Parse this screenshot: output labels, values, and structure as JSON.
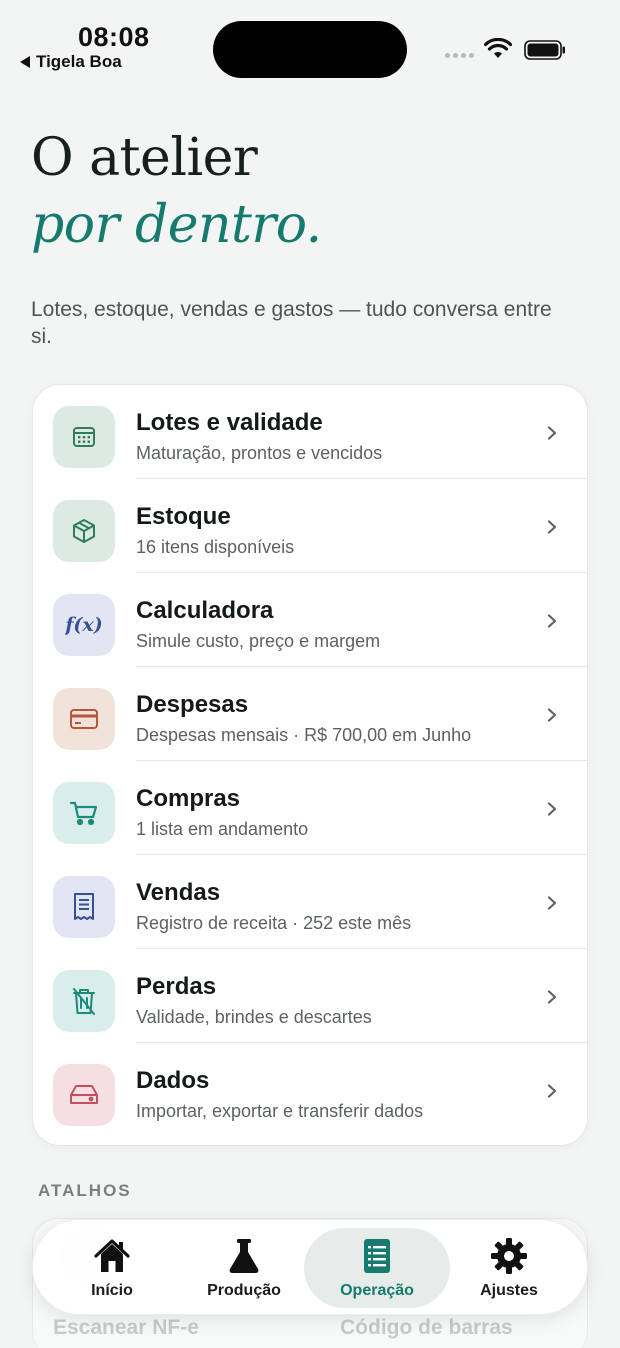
{
  "status_bar": {
    "time": "08:08",
    "back_app": "Tigela Boa"
  },
  "heading": {
    "line1": "O atelier",
    "line2": "por dentro."
  },
  "subtitle": "Lotes, estoque, vendas e gastos — tudo conversa entre si.",
  "menu": {
    "items": [
      {
        "title": "Lotes e validade",
        "subtitle": "Maturação, prontos e vencidos",
        "icon": "calendar-icon",
        "bg": "#dde9e3",
        "fg": "#2f7d5b"
      },
      {
        "title": "Estoque",
        "subtitle": "16 itens disponíveis",
        "icon": "box-icon",
        "bg": "#dde9e3",
        "fg": "#2f7d5b"
      },
      {
        "title": "Calculadora",
        "subtitle": "Simule custo, preço e margem",
        "icon": "function-icon",
        "bg": "#e2e6f2",
        "fg": "#3b4f93"
      },
      {
        "title": "Despesas",
        "subtitle": "Despesas mensais · R$ 700,00 em Junho",
        "icon": "credit-card-icon",
        "bg": "#f1e2da",
        "fg": "#b8553a"
      },
      {
        "title": "Compras",
        "subtitle": "1 lista em andamento",
        "icon": "cart-icon",
        "bg": "#d9eeeb",
        "fg": "#1c8a7c"
      },
      {
        "title": "Vendas",
        "subtitle": "Registro de receita · 252 este mês",
        "icon": "receipt-icon",
        "bg": "#e2e6f2",
        "fg": "#3b4f93"
      },
      {
        "title": "Perdas",
        "subtitle": "Validade, brindes e descartes",
        "icon": "trash-icon",
        "bg": "#d9eeeb",
        "fg": "#1c8a7c"
      },
      {
        "title": "Dados",
        "subtitle": "Importar, exportar e transferir dados",
        "icon": "drive-icon",
        "bg": "#f5dfe2",
        "fg": "#c0505f"
      }
    ]
  },
  "shortcuts": {
    "section_label": "ATALHOS",
    "left_label": "Escanear NF-e",
    "right_label": "Código de barras"
  },
  "tab_bar": {
    "active": "Operação",
    "tabs": [
      {
        "label": "Início",
        "icon": "home-icon"
      },
      {
        "label": "Produção",
        "icon": "flask-icon"
      },
      {
        "label": "Operação",
        "icon": "document-icon"
      },
      {
        "label": "Ajustes",
        "icon": "gear-icon"
      }
    ]
  },
  "colors": {
    "accent": "#177a6e",
    "background": "#f3f5f4"
  }
}
